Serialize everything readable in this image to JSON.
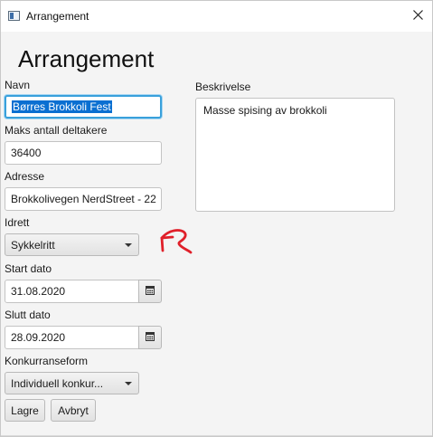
{
  "window": {
    "title": "Arrangement",
    "close_symbol": "✕"
  },
  "form": {
    "heading": "Arrangement",
    "navn": {
      "label": "Navn",
      "value": "Børres Brokkoli Fest"
    },
    "maks": {
      "label": "Maks antall deltakere",
      "value": "36400"
    },
    "adresse": {
      "label": "Adresse",
      "value": "Brokkolivegen NerdStreet - 22"
    },
    "idrett": {
      "label": "Idrett",
      "selected": "Sykkelritt"
    },
    "start": {
      "label": "Start dato",
      "value": "31.08.2020"
    },
    "slutt": {
      "label": "Slutt dato",
      "value": "28.09.2020"
    },
    "konkurranseform": {
      "label": "Konkurranseform",
      "selected": "Individuell konkur..."
    },
    "beskrivelse": {
      "label": "Beskrivelse",
      "value": "Masse spising av brokkoli"
    }
  },
  "buttons": {
    "save": "Lagre",
    "cancel": "Avbryt"
  },
  "colors": {
    "focus": "#39a0db",
    "selection": "#0a6fd1",
    "annotation": "#e0202a"
  },
  "icons": [
    "app-icon",
    "close-icon",
    "chevron-down-icon",
    "calendar-icon",
    "red-arrow-annotation"
  ]
}
